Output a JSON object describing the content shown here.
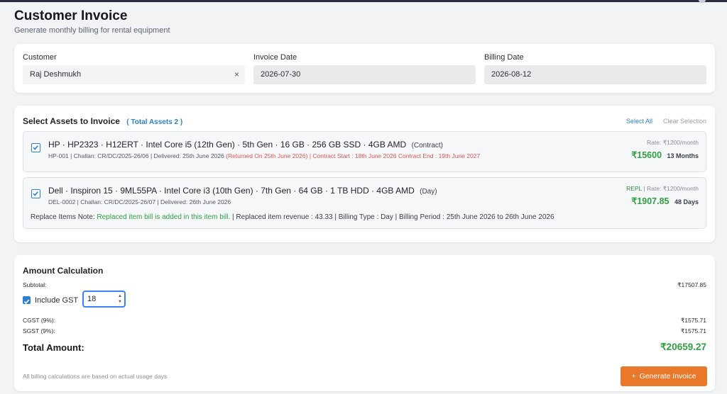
{
  "header": {
    "title": "Customer Invoice",
    "subtitle": "Generate monthly billing for rental equipment"
  },
  "form": {
    "customer": {
      "label": "Customer",
      "value": "Raj Deshmukh",
      "clear_icon": "×"
    },
    "invoice_date": {
      "label": "Invoice Date",
      "value": "2026-07-30"
    },
    "billing_date": {
      "label": "Billing Date",
      "value": "2026-08-12"
    }
  },
  "assets": {
    "heading": "Select Assets to Invoice",
    "total_label": "( Total Assets 2 )",
    "select_all": "Select All",
    "clear_selection": "Clear Selection",
    "items": [
      {
        "name": "HP · HP2323 · H12ERT · Intel Core i5 (12th Gen) · 5th Gen · 16 GB · 256 GB SSD · 4GB AMD",
        "type": "(Contract)",
        "meta": "HP-001 |  Challan: CR/DC/2025-26/06 | Delivered: 25th June 2026",
        "returned": "(Returned On 25th June 2026)",
        "contract": "| Contract Start : 18th June 2026 Contract End : 19th June 2027",
        "tag": "",
        "rate": "Rate: ₹1200/month",
        "price": "₹15600",
        "duration": "13 Months",
        "checked": true
      },
      {
        "name": "Dell · Inspiron 15 · 9ML55PA · Intel Core i3 (10th Gen) · 7th Gen · 64 GB · 1 TB HDD · 4GB AMD",
        "type": "(Day)",
        "meta": "DEL-0002 |  Challan: CR/DC/2025-26/07 | Delivered: 26th June 2026",
        "tag": "REPL",
        "rate": "| Rate: ₹1200/month",
        "price": "₹1907.85",
        "duration": "48 Days",
        "checked": true,
        "note_label": "Replace Items Note:",
        "note_value": "Replaced item bill is added in this item bill.",
        "note_rest": "| Replaced item revenue : 43.33 |  Billing Type : Day | Billing Period : 25th June 2026 to 26th June 2026"
      }
    ]
  },
  "amount": {
    "heading": "Amount Calculation",
    "subtotal_label": "Subtotal:",
    "subtotal_value": "₹17507.85",
    "gst_checkbox_label": "Include GST",
    "gst_checked": true,
    "gst_value": "18",
    "cgst_label": "CGST (9%):",
    "cgst_value": "₹1575.71",
    "sgst_label": "SGST (9%):",
    "sgst_value": "₹1575.71",
    "total_label": "Total Amount:",
    "total_value": "₹20659.27",
    "footnote": "All billing calculations are based on actual usage days",
    "generate_button": "Generate Invoice",
    "generate_icon": "+"
  },
  "colors": {
    "accent_blue": "#2f80d0",
    "price_green": "#2fa044",
    "alert_red": "#e2554f",
    "button_orange": "#e9782a"
  },
  "icons": [
    "close-icon",
    "checkbox-checked-icon",
    "plus-icon",
    "stepper-icon"
  ]
}
